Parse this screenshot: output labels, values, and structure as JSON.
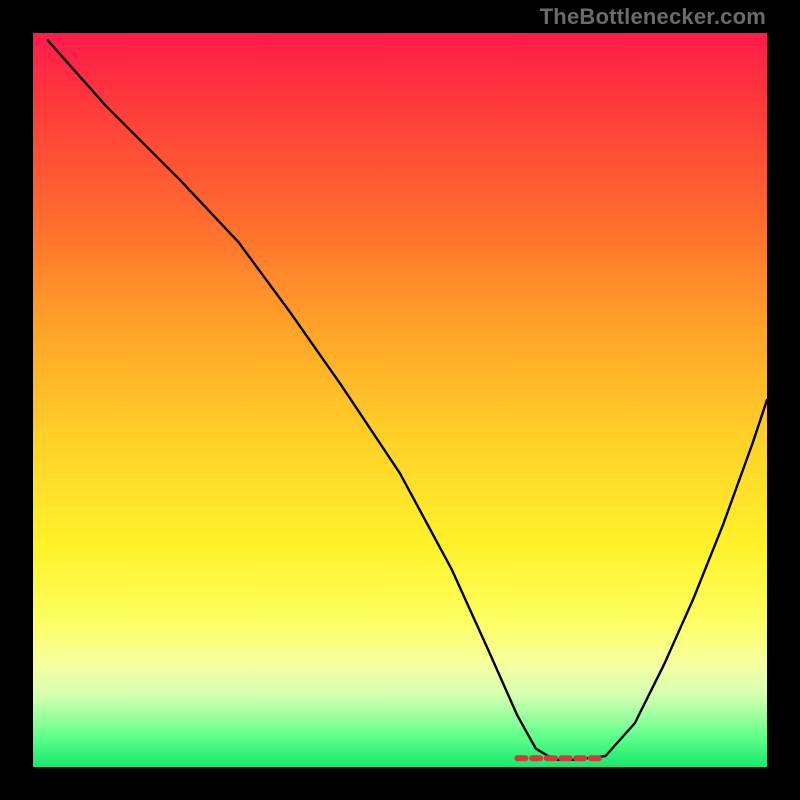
{
  "watermark": "TheBottlenecker.com",
  "chart_data": {
    "type": "line",
    "title": "",
    "xlabel": "",
    "ylabel": "",
    "xlim": [
      0,
      100
    ],
    "ylim": [
      0,
      100
    ],
    "grid": false,
    "legend": false,
    "series": [
      {
        "name": "curve",
        "x": [
          2,
          10,
          20,
          28,
          35,
          42,
          50,
          57,
          62,
          66,
          68.5,
          71,
          74,
          78,
          82,
          86,
          90,
          94,
          98,
          100
        ],
        "y": [
          99,
          90,
          80,
          71.5,
          62,
          52,
          40,
          27,
          16,
          7,
          2.5,
          1,
          1,
          1.5,
          6,
          14,
          23,
          33,
          44,
          50
        ]
      }
    ],
    "markers": [
      {
        "shape": "dashed-segment",
        "color": "#d33a3a",
        "x0": 66,
        "x1": 78,
        "y": 1.2
      }
    ],
    "background": "vertical-gradient red→orange→yellow→green"
  }
}
